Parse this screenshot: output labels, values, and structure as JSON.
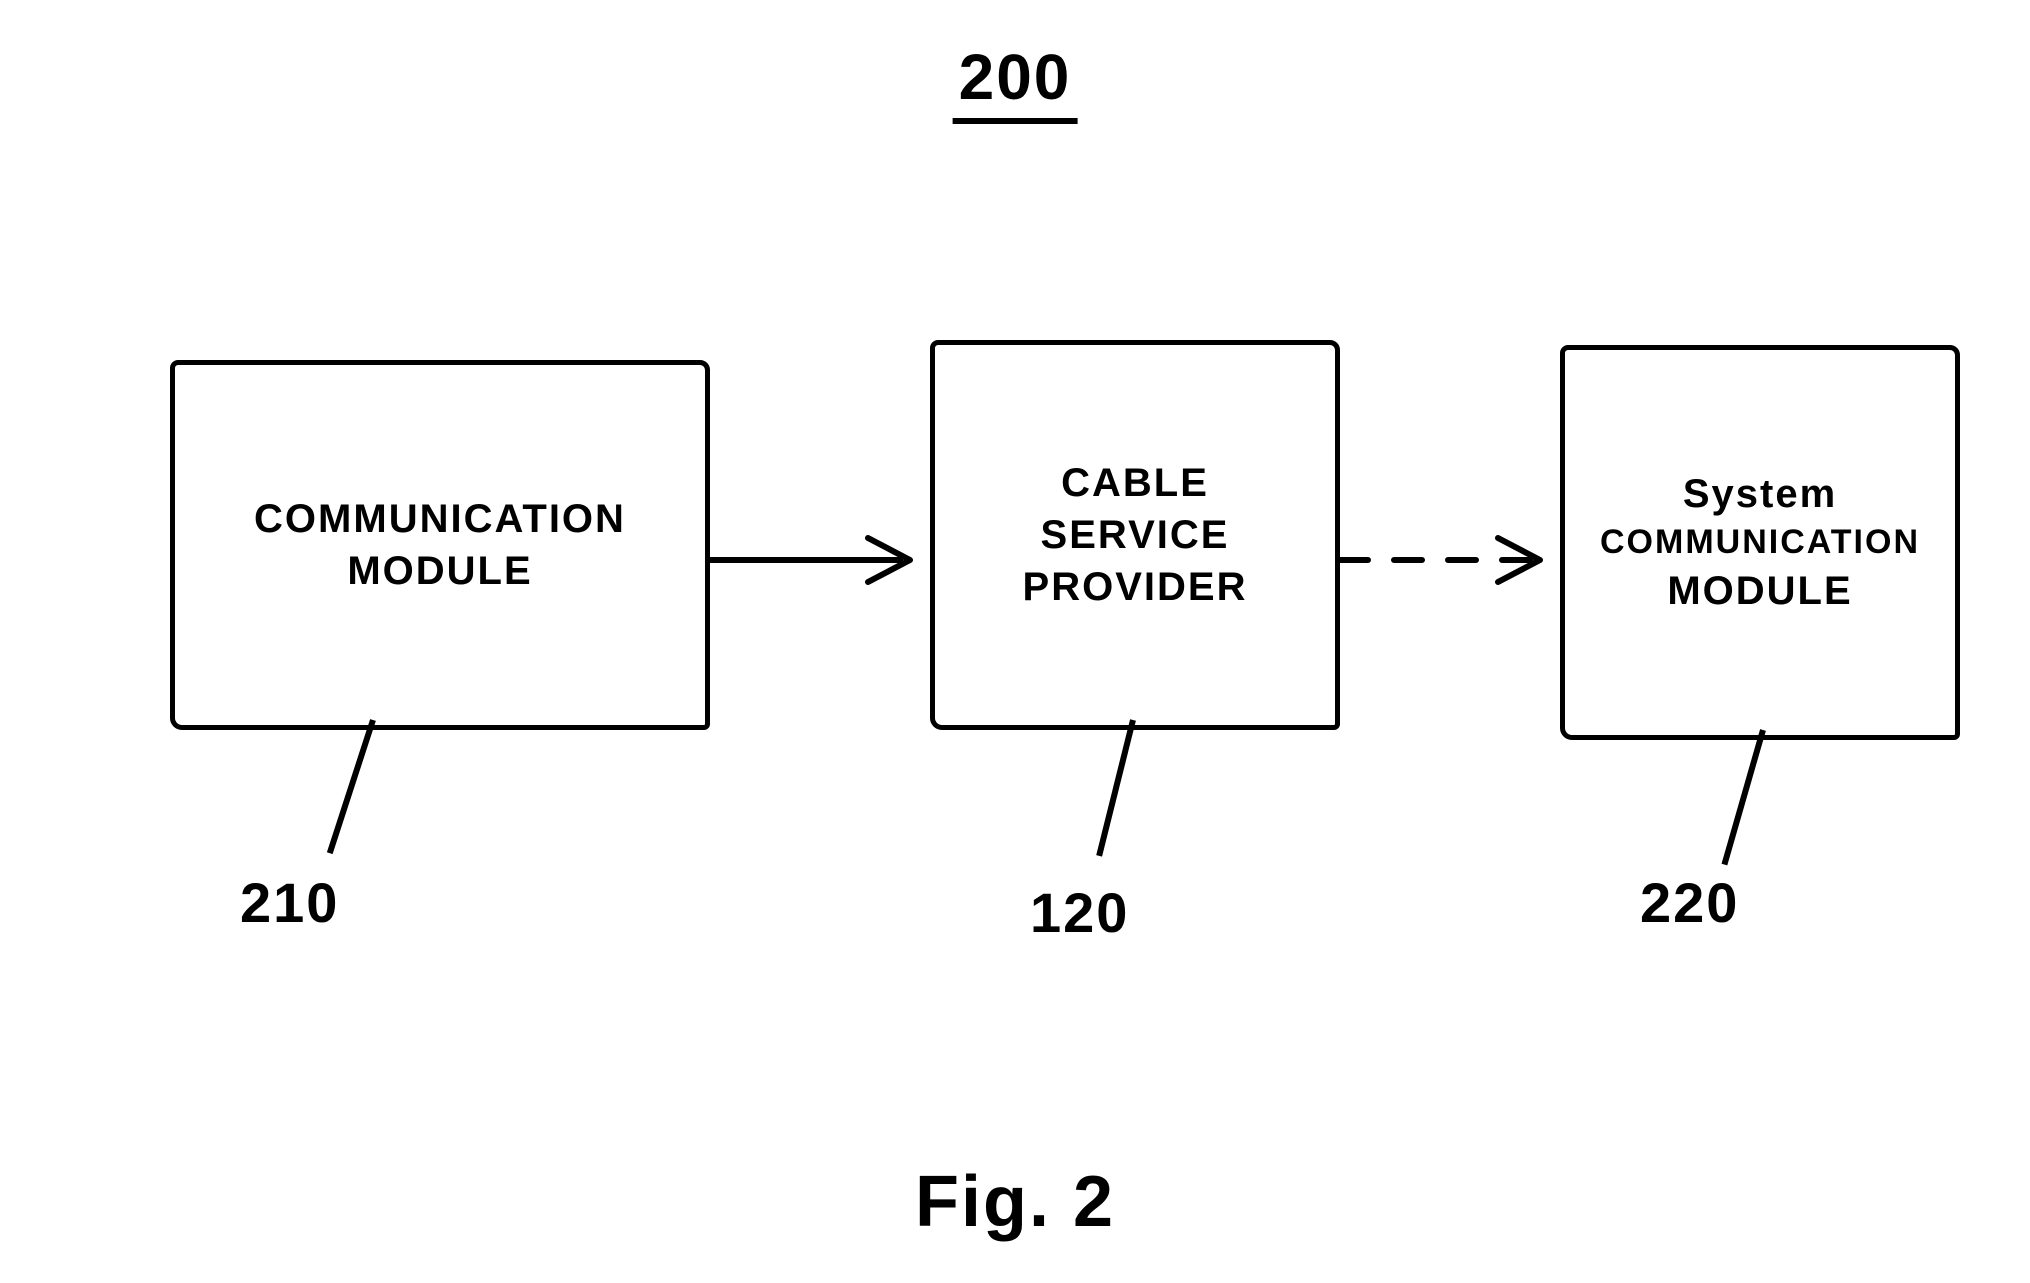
{
  "figure_number": "200",
  "figure_caption": "Fig. 2",
  "blocks": {
    "left": {
      "line1": "COMMUNICATION",
      "line2": "MODULE",
      "ref": "210"
    },
    "center": {
      "line1": "CABLE",
      "line2": "SERVICE",
      "line3": "PROVIDER",
      "ref": "120"
    },
    "right": {
      "line1": "System",
      "line2": "COMMUNICATION",
      "line3": "MODULE",
      "ref": "220"
    }
  },
  "connectors": {
    "left_to_center": {
      "style": "solid",
      "direction": "right"
    },
    "center_to_right": {
      "style": "dashed",
      "direction": "right"
    }
  }
}
